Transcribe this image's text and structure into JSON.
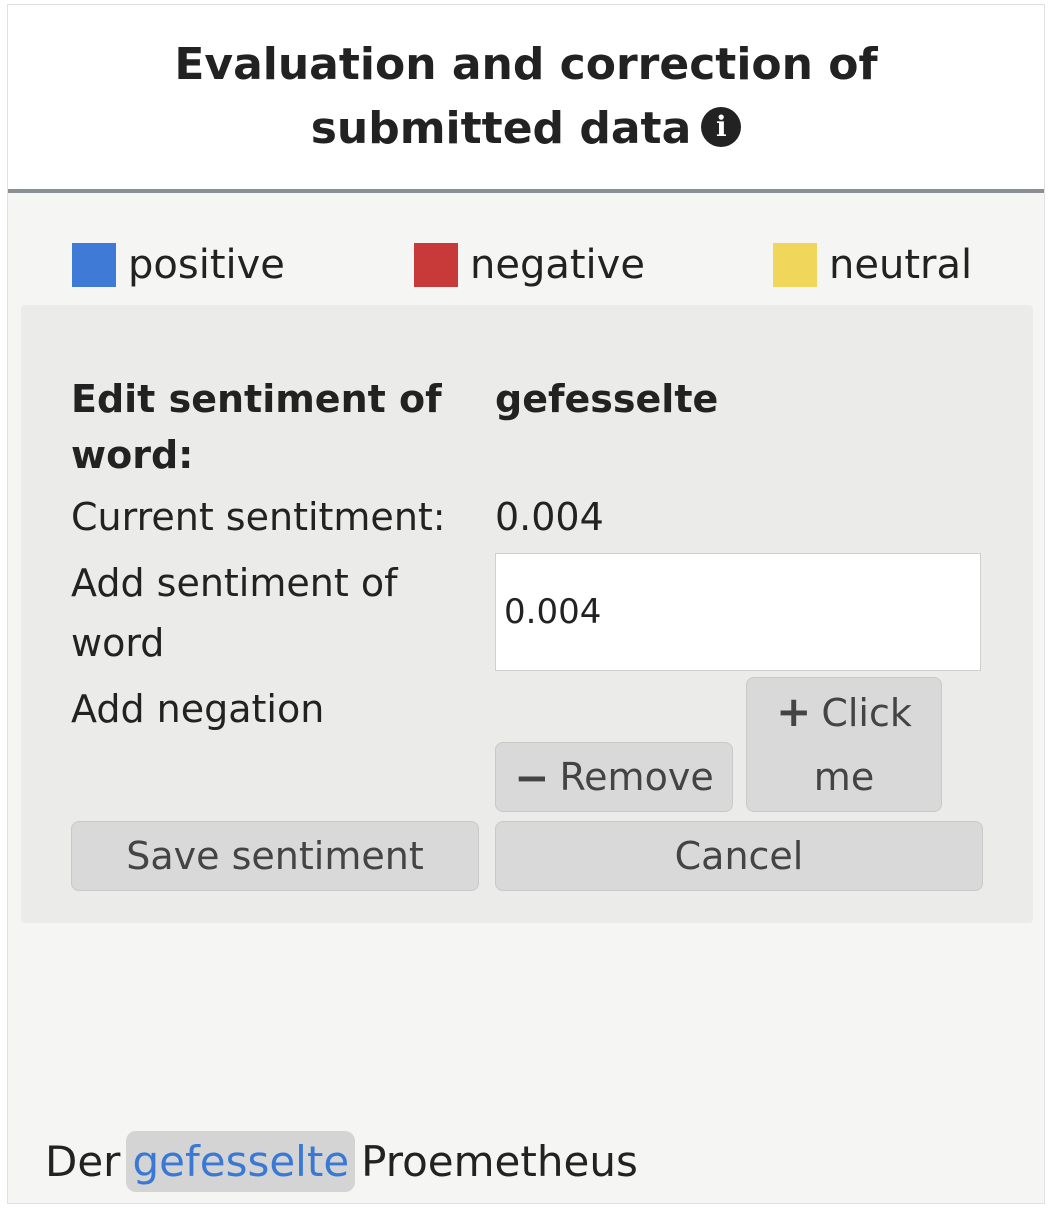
{
  "header": {
    "title": "Evaluation and correction of submitted data",
    "info_icon": "info-icon"
  },
  "legend": {
    "items": [
      {
        "label": "positive",
        "color": "#3f7ad6"
      },
      {
        "label": "negative",
        "color": "#c83a3a"
      },
      {
        "label": "neutral",
        "color": "#f0d65a"
      }
    ]
  },
  "editor": {
    "edit_label": "Edit sentiment of word:",
    "word": "gefesselte",
    "current_label": "Current sentitment:",
    "current_value": "0.004",
    "add_label": "Add sentiment of word",
    "add_value": "0.004",
    "negation_label": "Add negation",
    "remove_label": "Remove",
    "click_label": "Click me",
    "save_label": "Save sentiment",
    "cancel_label": "Cancel",
    "icons": {
      "remove": "minus-icon",
      "click": "plus-icon"
    }
  },
  "sentence": {
    "before": "Der",
    "highlighted": "gefesselte",
    "after": "Proemetheus"
  }
}
